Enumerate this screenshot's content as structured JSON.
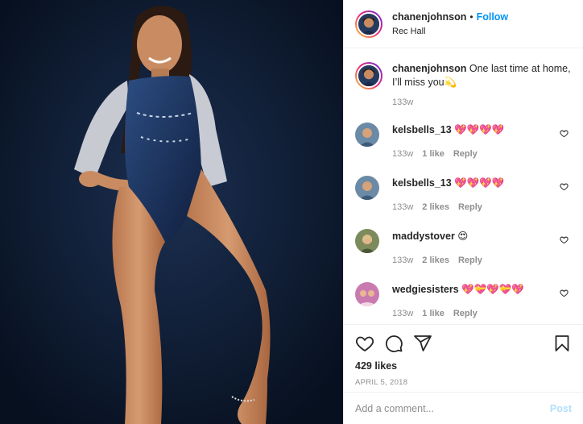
{
  "post": {
    "photo_alt": "",
    "header": {
      "username": "chanenjohnson",
      "separator": "•",
      "follow_label": "Follow",
      "location": "Rec Hall"
    },
    "caption": {
      "username": "chanenjohnson",
      "text": "One last time at home, I’ll miss you💫",
      "time": "133w"
    },
    "comments": [
      {
        "username": "kelsbells_13",
        "text": "💖💖💖💖",
        "time": "133w",
        "likes": "1 like",
        "reply": "Reply",
        "avatar_color": "#6b8aa6"
      },
      {
        "username": "kelsbells_13",
        "text": "💖💖💖💖",
        "time": "133w",
        "likes": "2 likes",
        "reply": "Reply",
        "avatar_color": "#6b8aa6"
      },
      {
        "username": "maddystover",
        "text": "😍",
        "time": "133w",
        "likes": "2 likes",
        "reply": "Reply",
        "avatar_color": "#7d8a5c"
      },
      {
        "username": "wedgiesisters",
        "text": "💖💝💖💝💖",
        "time": "133w",
        "likes": "1 like",
        "reply": "Reply",
        "avatar_color": "#c97bb0"
      }
    ],
    "likes": "429 likes",
    "date": "APRIL 5, 2018",
    "add_comment": {
      "placeholder": "Add a comment...",
      "post_label": "Post"
    },
    "icons": {
      "like": "heart-icon",
      "comment": "comment-icon",
      "share": "share-icon",
      "save": "bookmark-icon",
      "comment_like": "heart-icon"
    },
    "colors": {
      "accent": "#0095f6",
      "muted": "#8e8e8e",
      "post_disabled": "#b2dffc",
      "photo_background": "#0c1a33"
    }
  }
}
